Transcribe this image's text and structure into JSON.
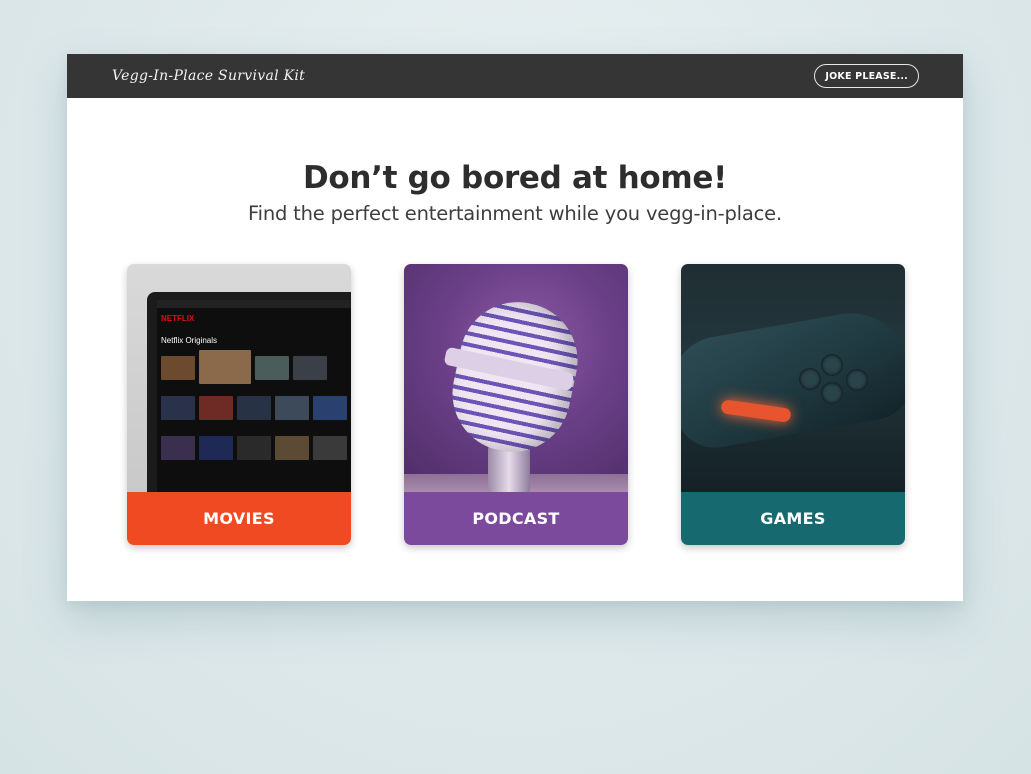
{
  "navbar": {
    "brand": "Vegg-In-Place Survival Kit",
    "joke_button": "JOKE PLEASE..."
  },
  "hero": {
    "title": "Don’t go bored at home!",
    "subtitle": "Find the perfect entertainment while you vegg-in-place."
  },
  "cards": [
    {
      "label": "MOVIES",
      "color": "#f04a23",
      "image": "netflix-laptop-image"
    },
    {
      "label": "PODCAST",
      "color": "#7b4a9c",
      "image": "microphone-image"
    },
    {
      "label": "GAMES",
      "color": "#166a6f",
      "image": "game-controller-image"
    }
  ],
  "movies_screen": {
    "logo": "NETFLIX",
    "row_title": "Netflix Originals"
  }
}
